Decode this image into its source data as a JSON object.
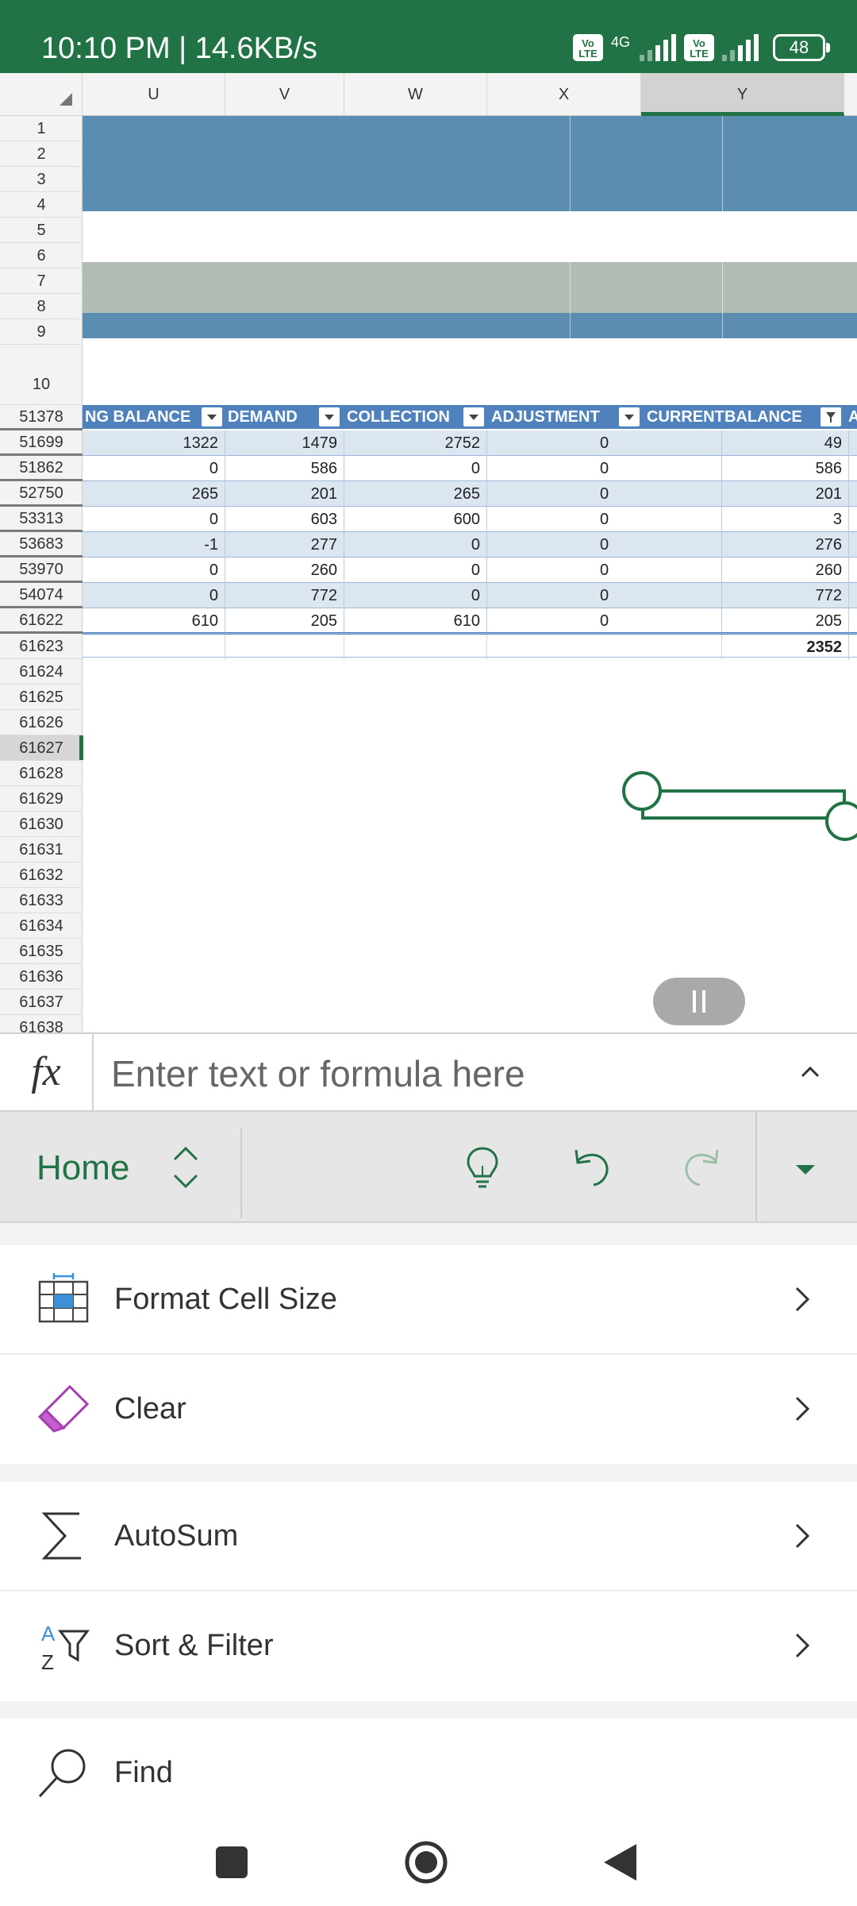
{
  "status_bar": {
    "time": "10:10 PM | 14.6KB/s",
    "volte_1": "Vo LTE",
    "network": "4G",
    "volte_2": "Vo LTE",
    "battery": "48",
    "color": "#217346"
  },
  "grid": {
    "columns": [
      "U",
      "V",
      "W",
      "X",
      "Y"
    ],
    "selected_column": "Y",
    "top_rows": [
      "1",
      "2",
      "3",
      "4",
      "5",
      "6",
      "7",
      "8",
      "9",
      "10"
    ],
    "table_header": [
      "NG BALANCE",
      "DEMAND",
      "COLLECTION",
      "ADJUSTMENT",
      "CURRENT",
      "BALANCE",
      "A"
    ],
    "data_rows": [
      {
        "row": "51378",
        "cells": [
          "1322",
          "1479",
          "2752",
          "0",
          "49"
        ]
      },
      {
        "row": "51699",
        "cells": [
          "0",
          "586",
          "0",
          "0",
          "586"
        ]
      },
      {
        "row": "51862",
        "cells": [
          "265",
          "201",
          "265",
          "0",
          "201"
        ]
      },
      {
        "row": "52750",
        "cells": [
          "0",
          "603",
          "600",
          "0",
          "3"
        ]
      },
      {
        "row": "53313",
        "cells": [
          "-1",
          "277",
          "0",
          "0",
          "276"
        ]
      },
      {
        "row": "53683",
        "cells": [
          "0",
          "260",
          "0",
          "0",
          "260"
        ]
      },
      {
        "row": "53970",
        "cells": [
          "0",
          "772",
          "0",
          "0",
          "772"
        ]
      },
      {
        "row": "54074",
        "cells": [
          "610",
          "205",
          "610",
          "0",
          "205"
        ]
      }
    ],
    "total_row": {
      "row": "61622",
      "value": "2352"
    },
    "empty_rows": [
      "61623",
      "61624",
      "61625",
      "61626",
      "61627",
      "61628",
      "61629",
      "61630",
      "61631",
      "61632",
      "61633",
      "61634",
      "61635",
      "61636",
      "61637",
      "61638"
    ],
    "active_row": "61627",
    "colors": {
      "band_blue": "#5b8db1",
      "band_grey": "#b1bcb3",
      "header_blue": "#4f81bd",
      "row_alt": "#dce6f1"
    }
  },
  "formula_bar": {
    "fx_label": "fx",
    "placeholder": "Enter text or formula here"
  },
  "ribbon": {
    "tab_label": "Home",
    "icons": [
      "lightbulb-icon",
      "undo-icon",
      "redo-icon",
      "dropdown-icon"
    ]
  },
  "menu": {
    "items": [
      {
        "label": "Format Cell Size",
        "icon": "format-cell-size-icon"
      },
      {
        "label": "Clear",
        "icon": "eraser-icon"
      },
      {
        "label": "AutoSum",
        "icon": "sigma-icon"
      },
      {
        "label": "Sort & Filter",
        "icon": "sort-filter-icon"
      },
      {
        "label": "Find",
        "icon": "magnifier-icon"
      }
    ],
    "sort_icon_letters": {
      "top": "A",
      "bottom": "Z"
    }
  },
  "nav_bar": {
    "buttons": [
      "recents-button",
      "home-button",
      "back-button"
    ]
  }
}
